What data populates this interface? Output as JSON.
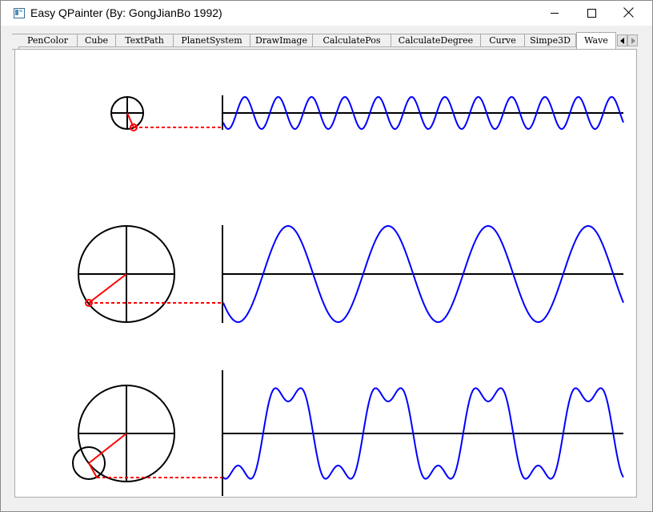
{
  "window": {
    "title": "Easy QPainter (By: GongJianBo 1992)",
    "icon": "app-window-icon",
    "controls": [
      "minimize-icon",
      "maximize-icon",
      "close-icon"
    ]
  },
  "tabs": {
    "items": [
      "PenColor",
      "Cube",
      "TextPath",
      "PlanetSystem",
      "DrawImage",
      "CalculatePos",
      "CalculateDegree",
      "Curve",
      "Simpe3D",
      "Wave"
    ],
    "active": "Wave",
    "scroll_icons": [
      "arrow-left-icon",
      "arrow-right-icon"
    ]
  },
  "wave_view": {
    "colors": {
      "axis": "#000000",
      "wave": "#0000ff",
      "radius": "#ff0000",
      "projection": "#ff0000"
    },
    "rows": [
      {
        "name": "small-sine",
        "amplitude_ratio": 0.2,
        "cycles_visible": 12,
        "has_harmonic": false
      },
      {
        "name": "large-sine",
        "amplitude_ratio": 0.6,
        "cycles_visible": 4,
        "has_harmonic": false
      },
      {
        "name": "sine-with-harmonic",
        "amplitude_ratio": 0.6,
        "cycles_visible": 4,
        "has_harmonic": true
      }
    ]
  }
}
